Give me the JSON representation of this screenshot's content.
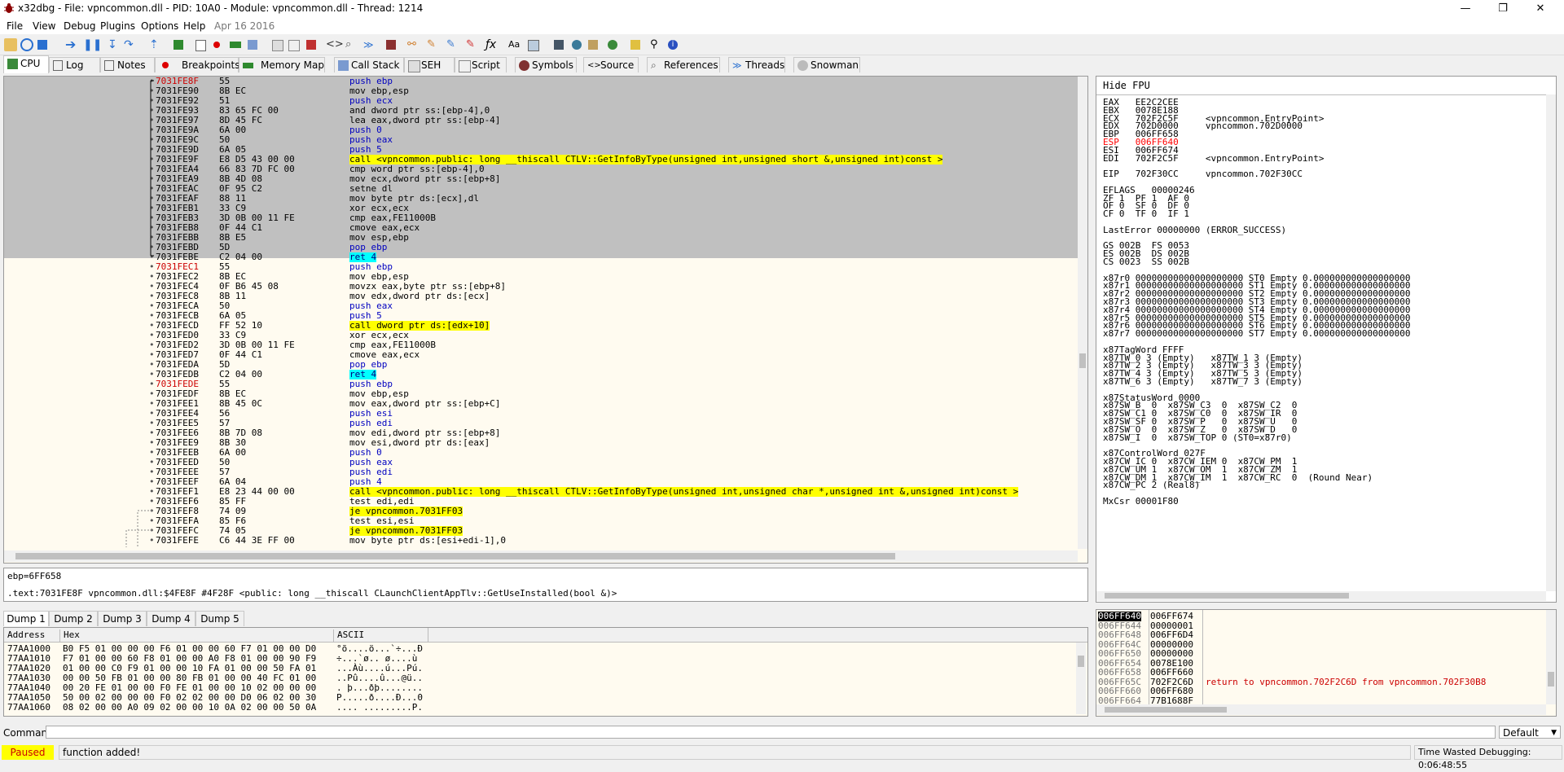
{
  "window": {
    "title": "x32dbg - File: vpncommon.dll - PID: 10A0 - Module: vpncommon.dll - Thread: 1214",
    "minimize": "—",
    "maximize": "❐",
    "close": "✕"
  },
  "menu": [
    "File",
    "View",
    "Debug",
    "Plugins",
    "Options",
    "Help"
  ],
  "menu_date": "Apr 16 2016",
  "tabs": [
    "CPU",
    "Log",
    "Notes",
    "Breakpoints",
    "Memory Map",
    "Call Stack",
    "SEH",
    "Script",
    "Symbols",
    "Source",
    "References",
    "Threads",
    "Snowman"
  ],
  "disasm": [
    {
      "addr": "7031FE8F",
      "bytes": "55",
      "asm": "push ebp",
      "type": "push",
      "red": true
    },
    {
      "addr": "7031FE90",
      "bytes": "8B EC",
      "asm": "mov ebp,esp"
    },
    {
      "addr": "7031FE92",
      "bytes": "51",
      "asm": "push ecx",
      "type": "push"
    },
    {
      "addr": "7031FE93",
      "bytes": "83 65 FC 00",
      "asm": "and dword ptr ss:[ebp-4],0"
    },
    {
      "addr": "7031FE97",
      "bytes": "8D 45 FC",
      "asm": "lea eax,dword ptr ss:[ebp-4]"
    },
    {
      "addr": "7031FE9A",
      "bytes": "6A 00",
      "asm": "push 0",
      "type": "push"
    },
    {
      "addr": "7031FE9C",
      "bytes": "50",
      "asm": "push eax",
      "type": "push"
    },
    {
      "addr": "7031FE9D",
      "bytes": "6A 05",
      "asm": "push 5",
      "type": "push"
    },
    {
      "addr": "7031FE9F",
      "bytes": "E8 D5 43 00 00",
      "asm": "call <vpncommon.public: long __thiscall CTLV::GetInfoByType(unsigned int,unsigned short &,unsigned int)const >",
      "type": "call"
    },
    {
      "addr": "7031FEA4",
      "bytes": "66 83 7D FC 00",
      "asm": "cmp word ptr ss:[ebp-4],0"
    },
    {
      "addr": "7031FEA9",
      "bytes": "8B 4D 08",
      "asm": "mov ecx,dword ptr ss:[ebp+8]"
    },
    {
      "addr": "7031FEAC",
      "bytes": "0F 95 C2",
      "asm": "setne dl"
    },
    {
      "addr": "7031FEAF",
      "bytes": "88 11",
      "asm": "mov byte ptr ds:[ecx],dl"
    },
    {
      "addr": "7031FEB1",
      "bytes": "33 C9",
      "asm": "xor ecx,ecx"
    },
    {
      "addr": "7031FEB3",
      "bytes": "3D 0B 00 11 FE",
      "asm": "cmp eax,FE11000B"
    },
    {
      "addr": "7031FEB8",
      "bytes": "0F 44 C1",
      "asm": "cmove eax,ecx"
    },
    {
      "addr": "7031FEBB",
      "bytes": "8B E5",
      "asm": "mov esp,ebp"
    },
    {
      "addr": "7031FEBD",
      "bytes": "5D",
      "asm": "pop ebp",
      "type": "push"
    },
    {
      "addr": "7031FEBE",
      "bytes": "C2 04 00",
      "asm": "ret 4",
      "type": "ret"
    },
    {
      "addr": "7031FEC1",
      "bytes": "55",
      "asm": "push ebp",
      "type": "push",
      "red": true
    },
    {
      "addr": "7031FEC2",
      "bytes": "8B EC",
      "asm": "mov ebp,esp"
    },
    {
      "addr": "7031FEC4",
      "bytes": "0F B6 45 08",
      "asm": "movzx eax,byte ptr ss:[ebp+8]"
    },
    {
      "addr": "7031FEC8",
      "bytes": "8B 11",
      "asm": "mov edx,dword ptr ds:[ecx]"
    },
    {
      "addr": "7031FECA",
      "bytes": "50",
      "asm": "push eax",
      "type": "push"
    },
    {
      "addr": "7031FECB",
      "bytes": "6A 05",
      "asm": "push 5",
      "type": "push"
    },
    {
      "addr": "7031FECD",
      "bytes": "FF 52 10",
      "asm": "call dword ptr ds:[edx+10]",
      "type": "call"
    },
    {
      "addr": "7031FED0",
      "bytes": "33 C9",
      "asm": "xor ecx,ecx"
    },
    {
      "addr": "7031FED2",
      "bytes": "3D 0B 00 11 FE",
      "asm": "cmp eax,FE11000B"
    },
    {
      "addr": "7031FED7",
      "bytes": "0F 44 C1",
      "asm": "cmove eax,ecx"
    },
    {
      "addr": "7031FEDA",
      "bytes": "5D",
      "asm": "pop ebp",
      "type": "push"
    },
    {
      "addr": "7031FEDB",
      "bytes": "C2 04 00",
      "asm": "ret 4",
      "type": "ret"
    },
    {
      "addr": "7031FEDE",
      "bytes": "55",
      "asm": "push ebp",
      "type": "push",
      "red": true
    },
    {
      "addr": "7031FEDF",
      "bytes": "8B EC",
      "asm": "mov ebp,esp"
    },
    {
      "addr": "7031FEE1",
      "bytes": "8B 45 0C",
      "asm": "mov eax,dword ptr ss:[ebp+C]"
    },
    {
      "addr": "7031FEE4",
      "bytes": "56",
      "asm": "push esi",
      "type": "push"
    },
    {
      "addr": "7031FEE5",
      "bytes": "57",
      "asm": "push edi",
      "type": "push"
    },
    {
      "addr": "7031FEE6",
      "bytes": "8B 7D 08",
      "asm": "mov edi,dword ptr ss:[ebp+8]"
    },
    {
      "addr": "7031FEE9",
      "bytes": "8B 30",
      "asm": "mov esi,dword ptr ds:[eax]"
    },
    {
      "addr": "7031FEEB",
      "bytes": "6A 00",
      "asm": "push 0",
      "type": "push"
    },
    {
      "addr": "7031FEED",
      "bytes": "50",
      "asm": "push eax",
      "type": "push"
    },
    {
      "addr": "7031FEEE",
      "bytes": "57",
      "asm": "push edi",
      "type": "push"
    },
    {
      "addr": "7031FEEF",
      "bytes": "6A 04",
      "asm": "push 4",
      "type": "push"
    },
    {
      "addr": "7031FEF1",
      "bytes": "E8 23 44 00 00",
      "asm": "call <vpncommon.public: long __thiscall CTLV::GetInfoByType(unsigned int,unsigned char *,unsigned int &,unsigned int)const >",
      "type": "call"
    },
    {
      "addr": "7031FEF6",
      "bytes": "85 FF",
      "asm": "test edi,edi"
    },
    {
      "addr": "7031FEF8",
      "bytes": "74 09",
      "asm": "je vpncommon.7031FF03",
      "type": "jmp"
    },
    {
      "addr": "7031FEFA",
      "bytes": "85 F6",
      "asm": "test esi,esi"
    },
    {
      "addr": "7031FEFC",
      "bytes": "74 05",
      "asm": "je vpncommon.7031FF03",
      "type": "jmp"
    },
    {
      "addr": "7031FEFE",
      "bytes": "C6 44 3E FF 00",
      "asm": "mov byte ptr ds:[esi+edi-1],0"
    }
  ],
  "registers": {
    "hide_fpu": "Hide FPU",
    "lines": [
      {
        "t": "EAX   EE2C2CEE"
      },
      {
        "t": "EBX   0078E188"
      },
      {
        "t": "ECX   702F2C5F     <vpncommon.EntryPoint>"
      },
      {
        "t": "EDX   702D0000     vpncommon.702D0000"
      },
      {
        "t": "EBP   006FF658"
      },
      {
        "t": "ESP   006FF640",
        "red": true
      },
      {
        "t": "ESI   006FF674"
      },
      {
        "t": "EDI   702F2C5F     <vpncommon.EntryPoint>"
      },
      {
        "t": ""
      },
      {
        "t": "EIP   702F30CC     vpncommon.702F30CC"
      },
      {
        "t": ""
      },
      {
        "t": "EFLAGS   00000246"
      },
      {
        "t": "ZF 1  PF 1  AF 0"
      },
      {
        "t": "OF 0  SF 0  DF 0"
      },
      {
        "t": "CF 0  TF 0  IF 1"
      },
      {
        "t": ""
      },
      {
        "t": "LastError 00000000 (ERROR_SUCCESS)"
      },
      {
        "t": ""
      },
      {
        "t": "GS 002B  FS 0053"
      },
      {
        "t": "ES 002B  DS 002B"
      },
      {
        "t": "CS 0023  SS 002B"
      },
      {
        "t": ""
      },
      {
        "t": "x87r0 00000000000000000000 ST0 Empty 0.000000000000000000"
      },
      {
        "t": "x87r1 00000000000000000000 ST1 Empty 0.000000000000000000"
      },
      {
        "t": "x87r2 00000000000000000000 ST2 Empty 0.000000000000000000"
      },
      {
        "t": "x87r3 00000000000000000000 ST3 Empty 0.000000000000000000"
      },
      {
        "t": "x87r4 00000000000000000000 ST4 Empty 0.000000000000000000"
      },
      {
        "t": "x87r5 00000000000000000000 ST5 Empty 0.000000000000000000"
      },
      {
        "t": "x87r6 00000000000000000000 ST6 Empty 0.000000000000000000"
      },
      {
        "t": "x87r7 00000000000000000000 ST7 Empty 0.000000000000000000"
      },
      {
        "t": ""
      },
      {
        "t": "x87TagWord FFFF"
      },
      {
        "t": "x87TW_0 3 (Empty)   x87TW_1 3 (Empty)"
      },
      {
        "t": "x87TW_2 3 (Empty)   x87TW_3 3 (Empty)"
      },
      {
        "t": "x87TW_4 3 (Empty)   x87TW_5 3 (Empty)"
      },
      {
        "t": "x87TW_6 3 (Empty)   x87TW_7 3 (Empty)"
      },
      {
        "t": ""
      },
      {
        "t": "x87StatusWord 0000"
      },
      {
        "t": "x87SW_B  0  x87SW_C3  0  x87SW_C2  0"
      },
      {
        "t": "x87SW_C1 0  x87SW_C0  0  x87SW_IR  0"
      },
      {
        "t": "x87SW_SF 0  x87SW_P   0  x87SW_U   0"
      },
      {
        "t": "x87SW_O  0  x87SW_Z   0  x87SW_D   0"
      },
      {
        "t": "x87SW_I  0  x87SW_TOP 0 (ST0=x87r0)"
      },
      {
        "t": ""
      },
      {
        "t": "x87ControlWord 027F"
      },
      {
        "t": "x87CW_IC 0  x87CW_IEM 0  x87CW_PM  1"
      },
      {
        "t": "x87CW_UM 1  x87CW_OM  1  x87CW_ZM  1"
      },
      {
        "t": "x87CW_DM 1  x87CW_IM  1  x87CW_RC  0  (Round Near)"
      },
      {
        "t": "x87CW_PC 2 (Real8)"
      },
      {
        "t": ""
      },
      {
        "t": "MxCsr 00001F80"
      }
    ]
  },
  "info": {
    "line1": "ebp=6FF658",
    "line2": ".text:7031FE8F vpncommon.dll:$4FE8F #4F28F <public: long __thiscall CLaunchClientAppTlv::GetUseInstalled(bool &)>"
  },
  "dump_tabs": [
    "Dump 1",
    "Dump 2",
    "Dump 3",
    "Dump 4",
    "Dump 5"
  ],
  "dump": {
    "headers": {
      "address": "Address",
      "hex": "Hex",
      "ascii": "ASCII"
    },
    "rows": [
      {
        "addr": "77AA1000",
        "hex": "B0 F5 01 00 00 00 F6 01 00 00 60 F7 01 00 00 D0",
        "ascii": "°õ....ö...`÷...Ð"
      },
      {
        "addr": "77AA1010",
        "hex": "F7 01 00 00 60 F8 01 00 00 A0 F8 01 00 00 90 F9",
        "ascii": "÷...`ø.. ø....ù"
      },
      {
        "addr": "77AA1020",
        "hex": "01 00 00 C0 F9 01 00 00 10 FA 01 00 00 50 FA 01",
        "ascii": "...Àù....ú...Pú."
      },
      {
        "addr": "77AA1030",
        "hex": "00 00 50 FB 01 00 00 80 FB 01 00 00 40 FC 01 00",
        "ascii": "..Pû....û...@ü.."
      },
      {
        "addr": "77AA1040",
        "hex": "00 20 FE 01 00 00 F0 FE 01 00 00 10 02 00 00 00",
        "ascii": ". þ...ðþ........"
      },
      {
        "addr": "77AA1050",
        "hex": "50 00 02 00 00 00 F0 02 02 00 00 D0 06 02 00 30",
        "ascii": "P.....ð....Ð...0"
      },
      {
        "addr": "77AA1060",
        "hex": "08 02 00 00 A0 09 02 00 00 10 0A 02 00 00 50 0A",
        "ascii": ".... .........P."
      }
    ]
  },
  "stack": [
    {
      "addr": "006FF640",
      "val": "006FF674",
      "cur": true
    },
    {
      "addr": "006FF644",
      "val": "00000001"
    },
    {
      "addr": "006FF648",
      "val": "006FF6D4"
    },
    {
      "addr": "006FF64C",
      "val": "00000000"
    },
    {
      "addr": "006FF650",
      "val": "00000000"
    },
    {
      "addr": "006FF654",
      "val": "0078E100"
    },
    {
      "addr": "006FF658",
      "val": "006FF660"
    },
    {
      "addr": "006FF65C",
      "val": "702F2C6D",
      "comment": "return to vpncommon.702F2C6D from vpncommon.702F30B8"
    },
    {
      "addr": "006FF660",
      "val": "006FF680"
    },
    {
      "addr": "006FF664",
      "val": "77B1688F"
    }
  ],
  "command": {
    "label": "Command:",
    "value": "",
    "dropdown": "Default"
  },
  "status": {
    "state": "Paused",
    "message": "function added!",
    "time": "Time Wasted Debugging: 0:06:48:55"
  }
}
